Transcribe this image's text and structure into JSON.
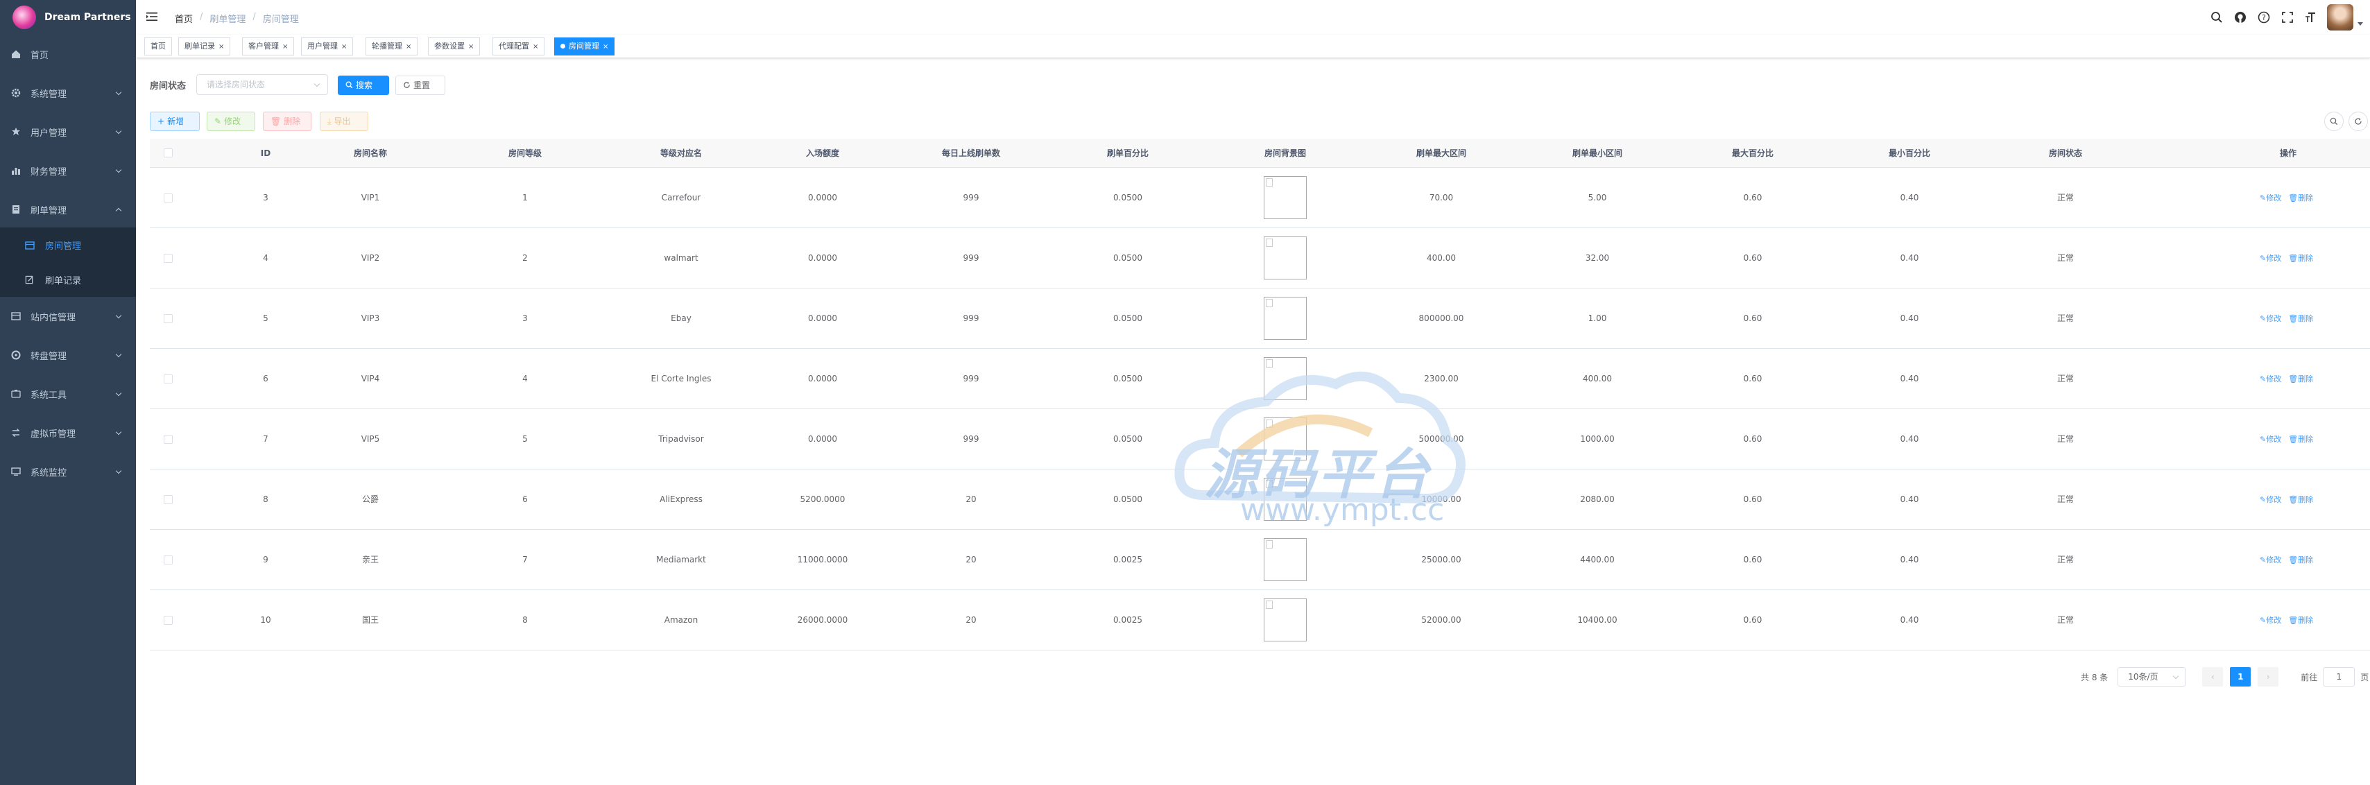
{
  "app": {
    "name": "Dream Partners"
  },
  "sidebar": {
    "items": [
      {
        "label": "首页",
        "icon": "home-icon"
      },
      {
        "label": "系统管理",
        "icon": "gear-icon"
      },
      {
        "label": "用户管理",
        "icon": "star-icon"
      },
      {
        "label": "财务管理",
        "icon": "bar-chart-icon"
      },
      {
        "label": "刷单管理",
        "icon": "document-icon"
      },
      {
        "label": "站内信管理",
        "icon": "table-icon"
      },
      {
        "label": "转盘管理",
        "icon": "disc-icon"
      },
      {
        "label": "系统工具",
        "icon": "tool-icon"
      },
      {
        "label": "虚拟币管理",
        "icon": "exchange-icon"
      },
      {
        "label": "系统监控",
        "icon": "monitor-icon"
      }
    ],
    "subitems": [
      {
        "label": "房间管理",
        "icon": "table-icon",
        "active": true
      },
      {
        "label": "刷单记录",
        "icon": "edit-icon",
        "active": false
      }
    ]
  },
  "header": {
    "breadcrumb": [
      "首页",
      "刷单管理",
      "房间管理"
    ]
  },
  "tags": [
    {
      "label": "首页",
      "closable": false
    },
    {
      "label": "刷单记录",
      "closable": true
    },
    {
      "label": "客户管理",
      "closable": true
    },
    {
      "label": "用户管理",
      "closable": true
    },
    {
      "label": "轮播管理",
      "closable": true
    },
    {
      "label": "参数设置",
      "closable": true
    },
    {
      "label": "代理配置",
      "closable": true
    },
    {
      "label": "房间管理",
      "closable": true,
      "active": true
    }
  ],
  "search": {
    "label": "房间状态",
    "placeholder": "请选择房间状态",
    "search_button": "搜索",
    "reset_button": "重置"
  },
  "toolbar": {
    "add": "新增",
    "edit": "修改",
    "delete": "删除",
    "export": "导出"
  },
  "table": {
    "columns": [
      "ID",
      "房间名称",
      "房间等级",
      "等级对应名",
      "入场额度",
      "每日上线刷单数",
      "刷单百分比",
      "房间背景图",
      "刷单最大区间",
      "刷单最小区间",
      "最大百分比",
      "最小百分比",
      "房间状态",
      "操作"
    ],
    "rows": [
      [
        "3",
        "VIP1",
        "1",
        "Carrefour",
        "0.0000",
        "999",
        "0.0500",
        "",
        "70.00",
        "5.00",
        "0.60",
        "0.40",
        "正常"
      ],
      [
        "4",
        "VIP2",
        "2",
        "walmart",
        "0.0000",
        "999",
        "0.0500",
        "",
        "400.00",
        "32.00",
        "0.60",
        "0.40",
        "正常"
      ],
      [
        "5",
        "VIP3",
        "3",
        "Ebay",
        "0.0000",
        "999",
        "0.0500",
        "",
        "800000.00",
        "1.00",
        "0.60",
        "0.40",
        "正常"
      ],
      [
        "6",
        "VIP4",
        "4",
        "El Corte Ingles",
        "0.0000",
        "999",
        "0.0500",
        "",
        "2300.00",
        "400.00",
        "0.60",
        "0.40",
        "正常"
      ],
      [
        "7",
        "VIP5",
        "5",
        "Tripadvisor",
        "0.0000",
        "999",
        "0.0500",
        "",
        "500000.00",
        "1000.00",
        "0.60",
        "0.40",
        "正常"
      ],
      [
        "8",
        "公爵",
        "6",
        "AliExpress",
        "5200.0000",
        "20",
        "0.0500",
        "",
        "10000.00",
        "2080.00",
        "0.60",
        "0.40",
        "正常"
      ],
      [
        "9",
        "亲王",
        "7",
        "Mediamarkt",
        "11000.0000",
        "20",
        "0.0025",
        "",
        "25000.00",
        "4400.00",
        "0.60",
        "0.40",
        "正常"
      ],
      [
        "10",
        "国王",
        "8",
        "Amazon",
        "26000.0000",
        "20",
        "0.0025",
        "",
        "52000.00",
        "10400.00",
        "0.60",
        "0.40",
        "正常"
      ]
    ],
    "op_edit": "修改",
    "op_delete": "删除"
  },
  "pagination": {
    "total": "共 8 条",
    "page_size": "10条/页",
    "current": "1",
    "goto_label": "前往",
    "goto_value": "1",
    "page_suffix": "页"
  },
  "watermark": {
    "cn": "源码平台",
    "url": "www.ympt.cc"
  },
  "colors": {
    "primary": "#1890ff",
    "sidebar": "#304156",
    "submenu": "#1f2d3d"
  }
}
